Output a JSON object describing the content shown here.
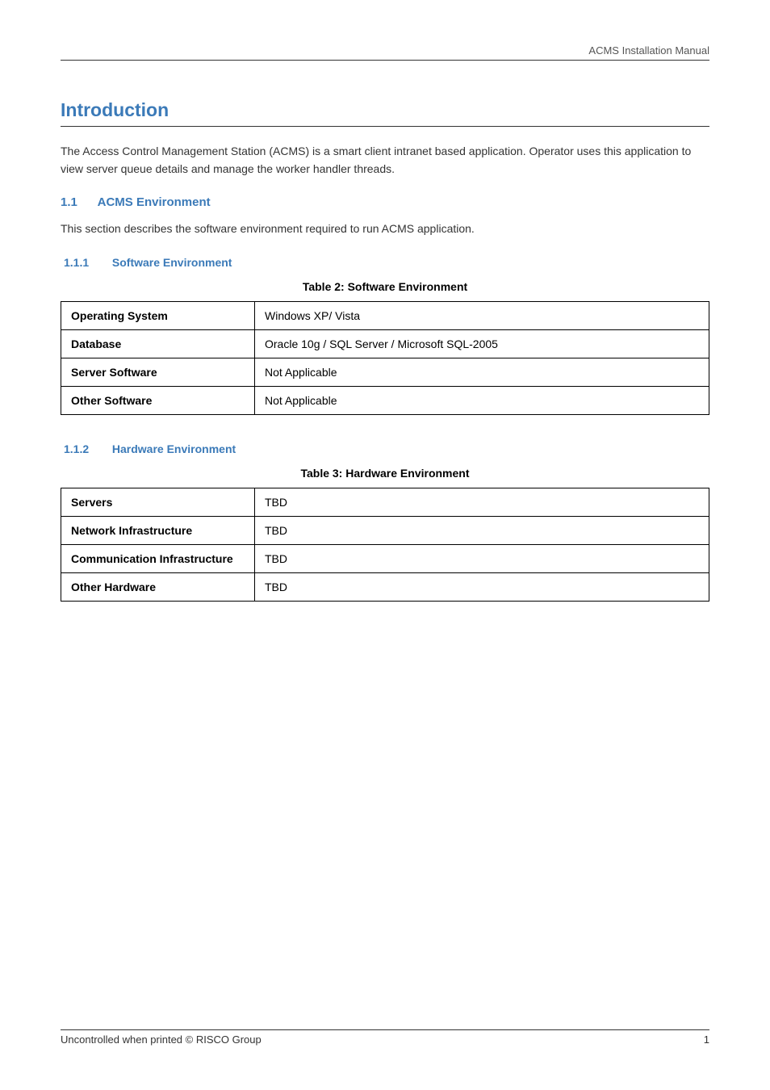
{
  "header": {
    "title": "ACMS Installation Manual"
  },
  "sections": {
    "intro": {
      "heading": "Introduction",
      "paragraph": "The Access Control Management Station (ACMS) is a smart client intranet based application. Operator uses this application to view server queue details and manage the worker handler threads."
    },
    "acms_env": {
      "num": "1.1",
      "heading": "ACMS Environment",
      "paragraph": "This section describes the software environment required to run ACMS application."
    },
    "software_env": {
      "num": "1.1.1",
      "heading": "Software Environment",
      "caption": "Table 2: Software Environment",
      "rows": [
        {
          "label": "Operating System",
          "value": "Windows XP/ Vista"
        },
        {
          "label": "Database",
          "value": "Oracle 10g / SQL Server / Microsoft SQL-2005"
        },
        {
          "label": "Server Software",
          "value": "Not Applicable"
        },
        {
          "label": "Other Software",
          "value": "Not Applicable"
        }
      ]
    },
    "hardware_env": {
      "num": "1.1.2",
      "heading": "Hardware Environment",
      "caption": "Table 3: Hardware Environment",
      "rows": [
        {
          "label": "Servers",
          "value": "TBD"
        },
        {
          "label": "Network Infrastructure",
          "value": "TBD"
        },
        {
          "label": "Communication Infrastructure",
          "value": "TBD"
        },
        {
          "label": "Other Hardware",
          "value": "TBD"
        }
      ]
    }
  },
  "footer": {
    "left": "Uncontrolled when printed © RISCO Group",
    "right": "1"
  }
}
